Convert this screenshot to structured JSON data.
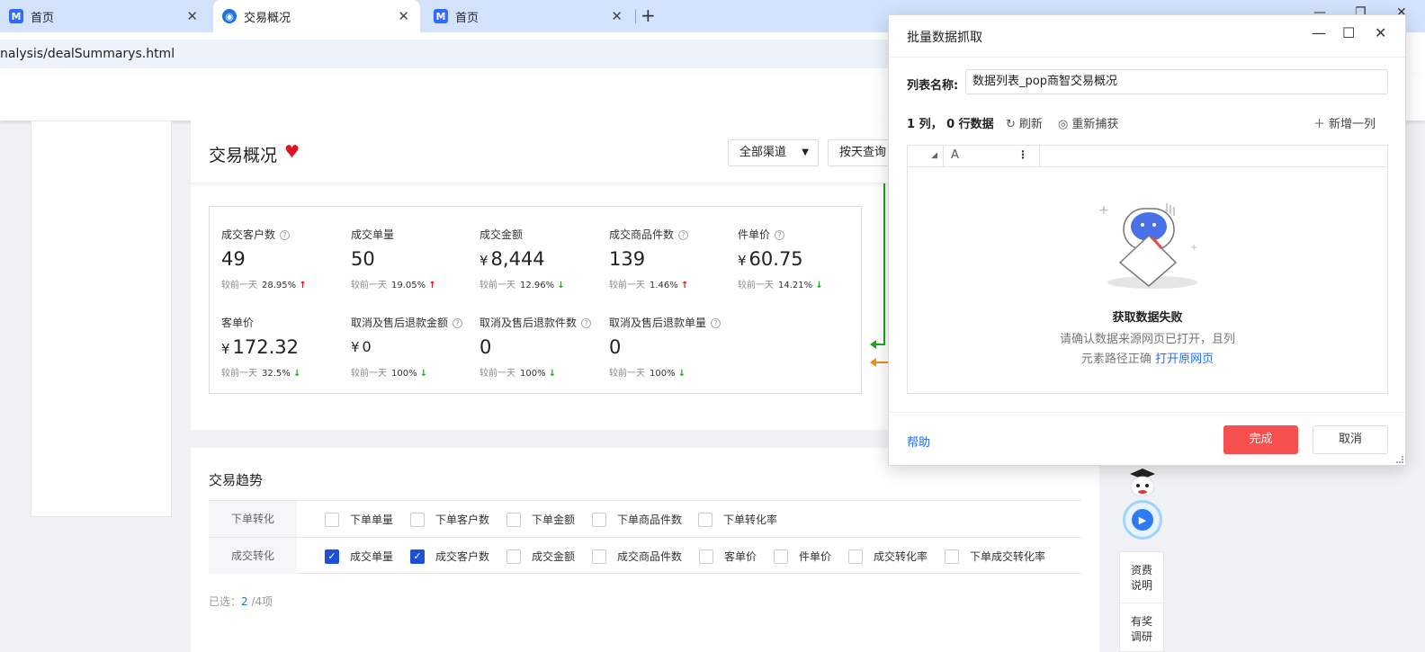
{
  "browser": {
    "tabs": [
      {
        "label": "首页",
        "favicon": "M"
      },
      {
        "label": "交易概况",
        "favicon": "globe"
      },
      {
        "label": "首页",
        "favicon": "M"
      }
    ],
    "url": "nalysis/dealSummarys.html"
  },
  "page": {
    "title": "交易概况",
    "channel_select": "全部渠道",
    "period_select": "按天查询",
    "compare_label": "较前一天",
    "metrics": [
      {
        "label": "成交客户数",
        "value": "49",
        "pct": "28.95%",
        "dir": "up",
        "help": true
      },
      {
        "label": "成交单量",
        "value": "50",
        "pct": "19.05%",
        "dir": "up",
        "help": false
      },
      {
        "label": "成交金额",
        "value": "8,444",
        "pct": "12.96%",
        "dir": "down",
        "help": false,
        "currency": "¥"
      },
      {
        "label": "成交商品件数",
        "value": "139",
        "pct": "1.46%",
        "dir": "up",
        "help": true
      },
      {
        "label": "件单价",
        "value": "60.75",
        "pct": "14.21%",
        "dir": "down",
        "help": true,
        "currency": "¥"
      },
      {
        "label": "客单价",
        "value": "172.32",
        "pct": "32.5%",
        "dir": "down",
        "help": false,
        "currency": "¥"
      },
      {
        "label": "取消及售后退款金额",
        "value": "0",
        "pct": "100%",
        "dir": "down",
        "help": true,
        "currency": "¥"
      },
      {
        "label": "取消及售后退款件数",
        "value": "0",
        "pct": "100%",
        "dir": "down",
        "help": true
      },
      {
        "label": "取消及售后退款单量",
        "value": "0",
        "pct": "100%",
        "dir": "down",
        "help": true
      }
    ],
    "trend": {
      "title": "交易趋势",
      "rows": [
        {
          "label": "下单转化",
          "options": [
            {
              "label": "下单单量",
              "checked": false
            },
            {
              "label": "下单客户数",
              "checked": false
            },
            {
              "label": "下单金额",
              "checked": false
            },
            {
              "label": "下单商品件数",
              "checked": false
            },
            {
              "label": "下单转化率",
              "checked": false
            }
          ]
        },
        {
          "label": "成交转化",
          "options": [
            {
              "label": "成交单量",
              "checked": true
            },
            {
              "label": "成交客户数",
              "checked": true
            },
            {
              "label": "成交金额",
              "checked": false
            },
            {
              "label": "成交商品件数",
              "checked": false
            },
            {
              "label": "客单价",
              "checked": false
            },
            {
              "label": "件单价",
              "checked": false
            },
            {
              "label": "成交转化率",
              "checked": false
            },
            {
              "label": "下单成交转化率",
              "checked": false
            }
          ]
        }
      ],
      "selected_prefix": "已选：",
      "selected_count": "2",
      "selected_suffix": " /4项"
    },
    "side_widgets": {
      "item1": "资费\n说明",
      "item2": "有奖\n调研"
    }
  },
  "dialog": {
    "title": "批量数据抓取",
    "list_name_label": "列表名称:",
    "list_name_value": "数据列表_pop商智交易概况",
    "stats": "1 列， 0 行数据",
    "refresh": "刷新",
    "recapture": "重新捕获",
    "add_column": "新增一列",
    "column_header": "A",
    "empty_title": "获取数据失败",
    "empty_desc_line1": "请确认数据来源网页已打开，且列",
    "empty_desc_line2": "元素路径正确",
    "open_page_link": "打开原网页",
    "help": "帮助",
    "done": "完成",
    "cancel": "取消"
  },
  "colors": {
    "accent_blue": "#1e6fff",
    "checkbox_blue": "#1e4fd8",
    "done_red": "#f5504e",
    "up_red": "#e4111e",
    "down_green": "#19a81b"
  }
}
